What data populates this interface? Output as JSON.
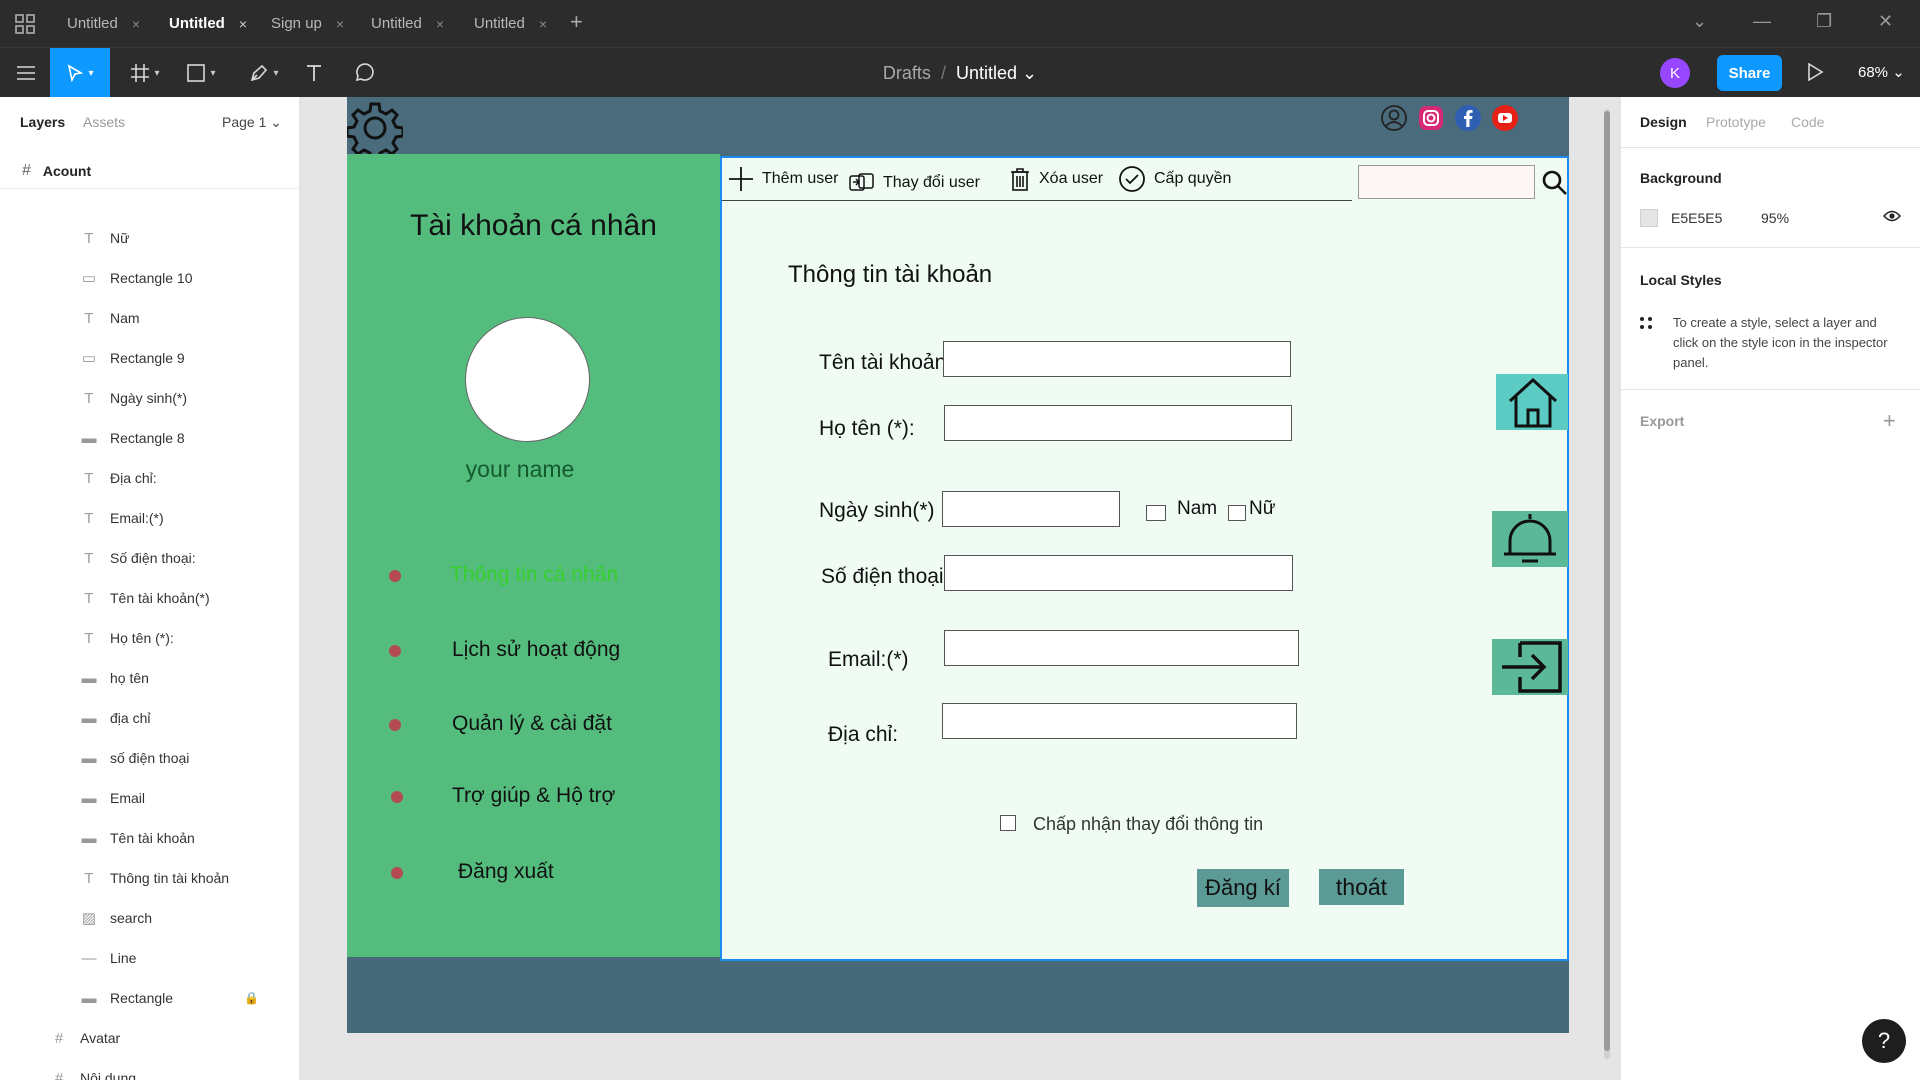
{
  "tabs": [
    {
      "label": "Untitled",
      "active": false
    },
    {
      "label": "Untitled",
      "active": true
    },
    {
      "label": "Sign up",
      "active": false
    },
    {
      "label": "Untitled",
      "active": false
    },
    {
      "label": "Untitled",
      "active": false
    }
  ],
  "tab_close": "×",
  "tab_add": "+",
  "window_controls": {
    "dropdown": "⌄",
    "minimize": "—",
    "restore": "❐",
    "close": "✕"
  },
  "toolbar": {
    "breadcrumb_drafts": "Drafts",
    "breadcrumb_sep": "/",
    "file_name": "Untitled ⌄",
    "avatar_initial": "K",
    "share_label": "Share",
    "zoom": "68% ⌄"
  },
  "left_panel": {
    "tab_layers": "Layers",
    "tab_assets": "Assets",
    "page": "Page 1 ⌄",
    "root_frame": "Acount",
    "layers": [
      {
        "type": "text",
        "icon": "T",
        "name": "Nữ"
      },
      {
        "type": "rect",
        "icon": "▭",
        "name": "Rectangle 10"
      },
      {
        "type": "text",
        "icon": "T",
        "name": "Nam"
      },
      {
        "type": "rect",
        "icon": "▭",
        "name": "Rectangle 9"
      },
      {
        "type": "text",
        "icon": "T",
        "name": "Ngày sinh(*)"
      },
      {
        "type": "rect-thin",
        "icon": "▬",
        "name": "Rectangle 8"
      },
      {
        "type": "text",
        "icon": "T",
        "name": "Địa chỉ:"
      },
      {
        "type": "text",
        "icon": "T",
        "name": "Email:(*)"
      },
      {
        "type": "text",
        "icon": "T",
        "name": "Số điện thoại:"
      },
      {
        "type": "text",
        "icon": "T",
        "name": "Tên tài khoản(*)"
      },
      {
        "type": "text",
        "icon": "T",
        "name": "Họ tên (*):"
      },
      {
        "type": "rect-thin",
        "icon": "▬",
        "name": "họ tên"
      },
      {
        "type": "rect-thin",
        "icon": "▬",
        "name": "địa chỉ"
      },
      {
        "type": "rect-thin",
        "icon": "▬",
        "name": "số điện thoại"
      },
      {
        "type": "rect-thin",
        "icon": "▬",
        "name": "Email"
      },
      {
        "type": "rect-thin",
        "icon": "▬",
        "name": "Tên tài khoản"
      },
      {
        "type": "text",
        "icon": "T",
        "name": "Thông tin tài khoản"
      },
      {
        "type": "image",
        "icon": "▨",
        "name": "search"
      },
      {
        "type": "line",
        "icon": "—",
        "name": "Line"
      },
      {
        "type": "rect-thin",
        "icon": "▬",
        "name": "Rectangle",
        "locked": true
      },
      {
        "type": "frame",
        "icon": "#",
        "name": "Avatar"
      },
      {
        "type": "frame",
        "icon": "#",
        "name": "Nội dụng"
      }
    ],
    "lock_icon": "🔒"
  },
  "design": {
    "panel_title": "Tài khoản cá nhân",
    "user_name": "your name",
    "menu": [
      {
        "label": "Thông tin cá nhân",
        "active": true
      },
      {
        "label": "Lịch sử hoạt động",
        "active": false
      },
      {
        "label": "Quản lý & cài đặt",
        "active": false
      },
      {
        "label": "Trợ giúp & Hộ trợ",
        "active": false
      },
      {
        "label": "Đăng xuất",
        "active": false
      }
    ],
    "actions": {
      "add_user": "Thêm user",
      "change_user": "Thay đổi user",
      "delete_user": "Xóa user",
      "grant": "Cấp quyền"
    },
    "form": {
      "heading": "Thông tin tài khoản",
      "account_label": "Tên tài khoản(*)",
      "fullname_label": "Họ tên (*):",
      "dob_label": "Ngày sinh(*)",
      "male_label": "Nam",
      "female_label": "Nữ",
      "phone_label": "Số điện thoại:",
      "email_label": "Email:(*)",
      "address_label": "Địa chỉ:",
      "accept_label": "Chấp nhận thay đổi thông tin",
      "register_label": "Đăng kí",
      "exit_label": "thoát"
    }
  },
  "right_panel": {
    "tab_design": "Design",
    "tab_prototype": "Prototype",
    "tab_code": "Code",
    "background_heading": "Background",
    "background_hex": "E5E5E5",
    "background_opacity": "95%",
    "local_styles_heading": "Local Styles",
    "local_styles_text": "To create a style, select a layer and click on the style icon in the inspector panel.",
    "export_heading": "Export",
    "export_add": "+"
  },
  "help_label": "?",
  "colors": {
    "accent": "#0d99ff",
    "frame_bg": "#466a7a",
    "green_panel": "#54bc7d",
    "form_bg": "#f0fbf4",
    "menu_dot": "#b44b53",
    "active_menu": "#37cf2c",
    "button_bg": "#5b9a95",
    "side_icon_bg": "#5ccbc4"
  }
}
